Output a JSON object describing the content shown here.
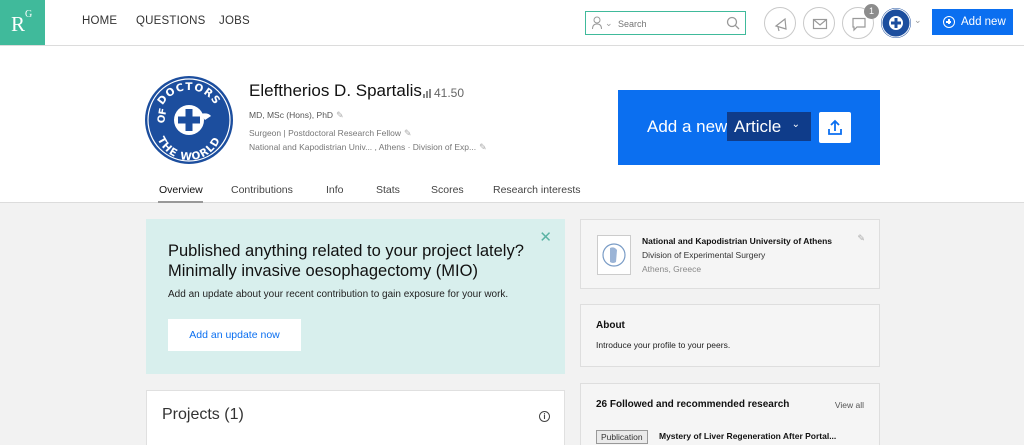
{
  "brand": {
    "logo_r": "R",
    "logo_g": "G"
  },
  "nav": {
    "items": [
      "HOME",
      "QUESTIONS",
      "JOBS"
    ]
  },
  "search": {
    "placeholder": "Search"
  },
  "notifications": {
    "count": "1"
  },
  "actions": {
    "add_new": "Add new"
  },
  "profile": {
    "name": "Eleftherios D. Spartalis",
    "rg_score": "41.50",
    "degrees": "MD, MSc (Hons), PhD",
    "position": "Surgeon | Postdoctoral Research Fellow",
    "institution": "National and Kapodistrian Univ... , Athens · Division of Exp..."
  },
  "banner": {
    "add_label": "Add a new",
    "type_value": "Article"
  },
  "tabs": [
    "Overview",
    "Contributions",
    "Info",
    "Stats",
    "Scores",
    "Research interests"
  ],
  "promo": {
    "headline_1": "Published anything related to your project lately?",
    "headline_2": "Minimally invasive oesophagectomy (MIO)",
    "body": "Add an update about your recent contribution to gain exposure for your work.",
    "button": "Add an update now"
  },
  "projects": {
    "title": "Projects (1)"
  },
  "institution_card": {
    "name": "National and Kapodistrian University of Athens",
    "department": "Division of Experimental Surgery",
    "location": "Athens, Greece"
  },
  "about": {
    "title": "About",
    "description": "Introduce your profile to your peers."
  },
  "followed": {
    "title": "26 Followed and recommended research",
    "view_all": "View all",
    "item_type": "Publication",
    "item_title": "Mystery of Liver Regeneration After Portal..."
  },
  "avatar_text": {
    "top": "DOCTORS",
    "left": "OF",
    "bottom": "THE WORLD"
  },
  "colors": {
    "brand": "#40ba9b",
    "primary": "#0b6ff0",
    "promo_bg": "#d8efed"
  }
}
